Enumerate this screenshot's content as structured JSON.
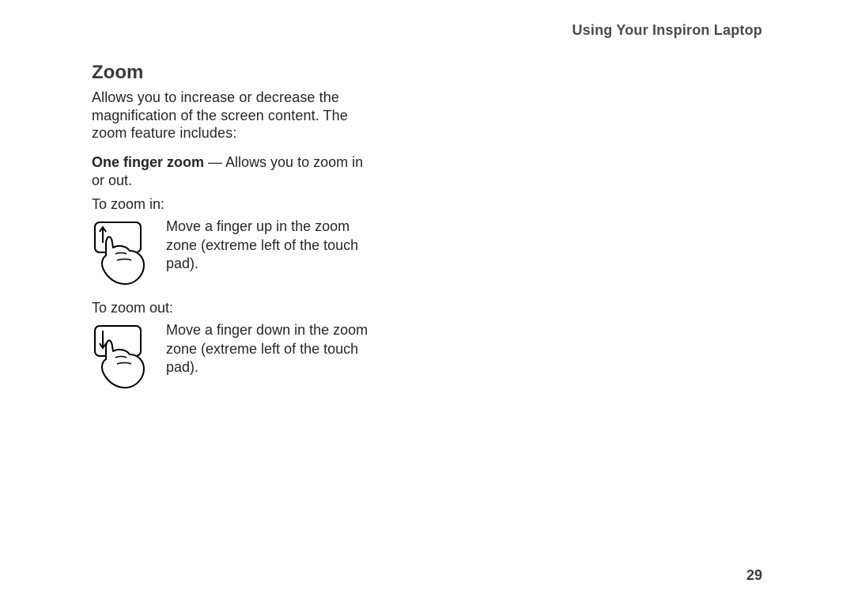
{
  "runningHead": "Using Your Inspiron Laptop",
  "heading": "Zoom",
  "intro": "Allows you to increase or decrease the magnification of the screen content. The zoom feature includes:",
  "feature": {
    "name": "One finger zoom",
    "dash": " — ",
    "desc": "Allows you to zoom in or out."
  },
  "zoomIn": {
    "label": "To zoom in:",
    "text": "Move a finger up in the zoom zone (extreme left of the touch pad)."
  },
  "zoomOut": {
    "label": "To zoom out:",
    "text": "Move a finger down in the zoom zone (extreme left of the touch pad)."
  },
  "pageNumber": "29"
}
